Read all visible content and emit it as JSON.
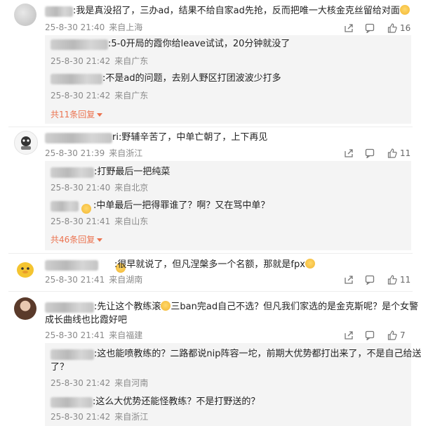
{
  "comments": [
    {
      "text": ":我是真没招了，三办ad，结果不给自家ad先抢，反而把唯一大核金克丝留给对面",
      "time": "25-8-30 21:40",
      "location": "来自上海",
      "likes": "16",
      "replies": [
        {
          "text": ":5-0开局的霞你给leave试试，20分钟就没了",
          "time": "25-8-30 21:42",
          "location": "来自广东"
        },
        {
          "text": ":不是ad的问题，去别人野区打团波波少打多",
          "time": "25-8-30 21:42",
          "location": "来自广东"
        }
      ],
      "more_replies": "共11条回复"
    },
    {
      "text": "ri:野辅辛苦了，中单亡朝了，上下再见",
      "time": "25-8-30 21:39",
      "location": "来自浙江",
      "likes": "11",
      "replies": [
        {
          "text": ":打野最后一把纯菜",
          "time": "25-8-30 21:40",
          "location": "来自北京"
        },
        {
          "text": ":中单最后一把得罪谁了？啊？又在骂中单？",
          "time": "25-8-30 21:41",
          "location": "来自山东"
        }
      ],
      "more_replies": "共46条回复"
    },
    {
      "text": ":很早就说了，但凡涅槃多一个名额，那就是fpx",
      "time": "25-8-30 21:41",
      "location": "来自湖南",
      "likes": "11",
      "replies": []
    },
    {
      "text_line1": ":先让这个教练滚",
      "text_line1b": "三ban完ad自己不选？但凡我们家选的是金克斯呢？是个女警",
      "text_line2": "成长曲线也比霞好吧",
      "time": "25-8-30 21:41",
      "location": "来自福建",
      "likes": "7",
      "replies": [
        {
          "text_line1": ":这也能喷教练的？二路都说nip阵容一坨，前期大优势都打出来了，不是自己给送",
          "text_line2": "了？",
          "time": "25-8-30 21:42",
          "location": "来自河南"
        },
        {
          "text": ":这么大优势还能怪教练？不是打野送的？",
          "time": "25-8-30 21:42",
          "location": "来自浙江"
        }
      ]
    }
  ],
  "icons": {
    "share": "share-icon",
    "comment": "comment-icon",
    "like": "thumbs-up-icon",
    "expand": "caret-down-icon"
  },
  "colors": {
    "accent": "#eb7350",
    "meta": "#8a8a8a",
    "reply_bg": "#f4f4f4"
  }
}
